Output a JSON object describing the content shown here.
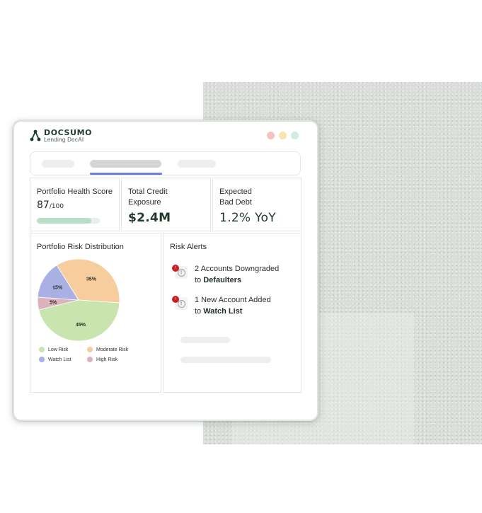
{
  "brand": {
    "name": "DOCSUMO",
    "subtitle": "Lending DocAI",
    "icon": "docsumo-logo-icon"
  },
  "window_controls": {
    "colors": [
      "#f7c1c1",
      "#f8e4b3",
      "#cfeedd"
    ]
  },
  "metrics": {
    "health": {
      "title": "Portfolio Health Score",
      "score": "87",
      "out_of": "/100",
      "progress_fraction": 0.87
    },
    "exposure": {
      "title_line1": "Total Credit",
      "title_line2": "Exposure",
      "value": "$2.4M"
    },
    "bad_debt": {
      "title_line1": "Expected",
      "title_line2": "Bad Debt",
      "value": "1.2% YoY"
    }
  },
  "distribution": {
    "title": "Portfolio Risk Distribution",
    "legend": [
      {
        "label": "Low Risk",
        "color": "#c9e4ae"
      },
      {
        "label": "Moderate Risk",
        "color": "#f8cd9d"
      },
      {
        "label": "Watch List",
        "color": "#a9b0e4"
      },
      {
        "label": "High Risk",
        "color": "#dcb2be"
      }
    ]
  },
  "chart_data": {
    "type": "pie",
    "categories": [
      "Low Risk",
      "Moderate Risk",
      "Watch List",
      "High Risk"
    ],
    "values": [
      45,
      35,
      15,
      5
    ],
    "labels": [
      "45%",
      "35%",
      "15%",
      "5%"
    ],
    "colors": [
      "#c9e4ae",
      "#f8cd9d",
      "#a9b0e4",
      "#dcb2be"
    ]
  },
  "alerts": {
    "title": "Risk Alerts",
    "badge": "!",
    "items": [
      {
        "line1": "2 Accounts Downgraded",
        "line2_prefix": "to ",
        "line2_bold": "Defaulters",
        "icon": "alert-warning-icon"
      },
      {
        "line1": "1 New Account Added",
        "line2_prefix": "to ",
        "line2_bold": "Watch List",
        "icon": "alert-warning-icon"
      }
    ]
  }
}
